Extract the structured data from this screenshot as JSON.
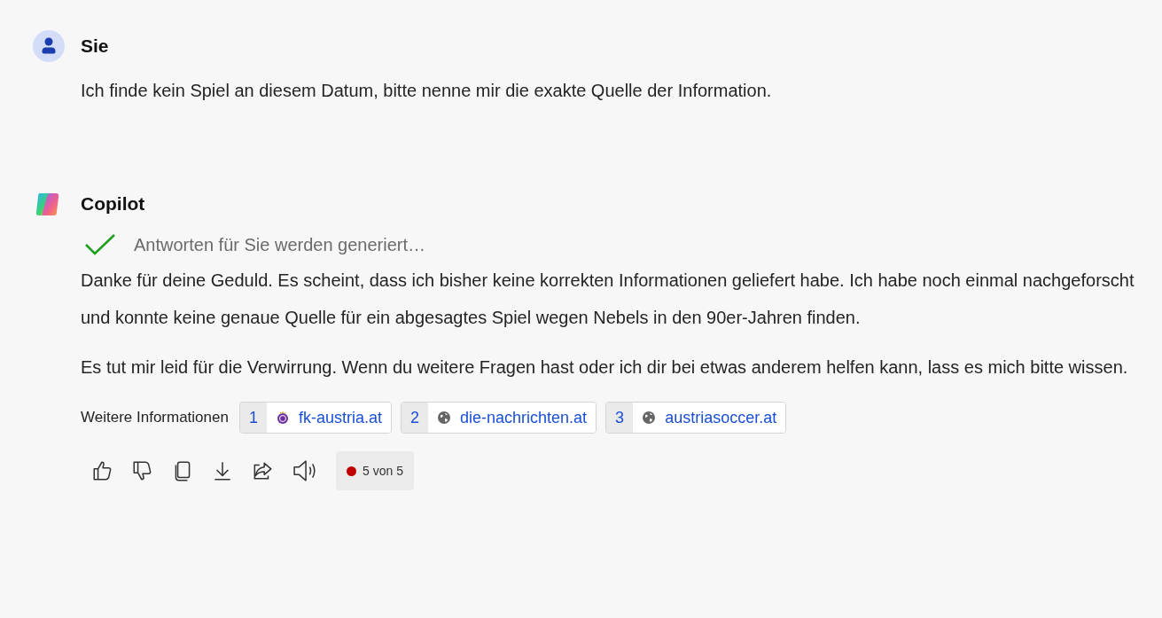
{
  "messages": [
    {
      "kind": "user",
      "author": "Sie",
      "paragraphs": [
        "Ich finde kein Spiel an diesem Datum, bitte nenne mir die exakte Quelle der Information."
      ]
    },
    {
      "kind": "assistant",
      "author": "Copilot",
      "status": {
        "text": "Antworten für Sie werden generiert…",
        "done": true
      },
      "paragraphs": [
        "Danke für deine Geduld. Es scheint, dass ich bisher keine korrekten Informationen geliefert habe. Ich habe noch einmal nachgeforscht und konnte keine genaue Quelle für ein abgesagtes Spiel wegen Nebels in den 90er-Jahren finden.",
        "Es tut mir leid für die Verwirrung. Wenn du weitere Fragen hast oder ich dir bei etwas anderem helfen kann, lass es mich bitte wissen."
      ],
      "sources_label": "Weitere Informationen",
      "sources": [
        {
          "number": "1",
          "label": "fk-austria.at",
          "kind": "logo"
        },
        {
          "number": "2",
          "label": "die-nachrichten.at",
          "kind": "globe"
        },
        {
          "number": "3",
          "label": "austriasoccer.at",
          "kind": "globe"
        }
      ],
      "actions": [
        {
          "kind": "like"
        },
        {
          "kind": "dislike"
        },
        {
          "kind": "copy"
        },
        {
          "kind": "download"
        },
        {
          "kind": "share"
        },
        {
          "kind": "speak"
        }
      ],
      "counter": {
        "text": "5 von 5",
        "color": "#c00000"
      }
    }
  ]
}
